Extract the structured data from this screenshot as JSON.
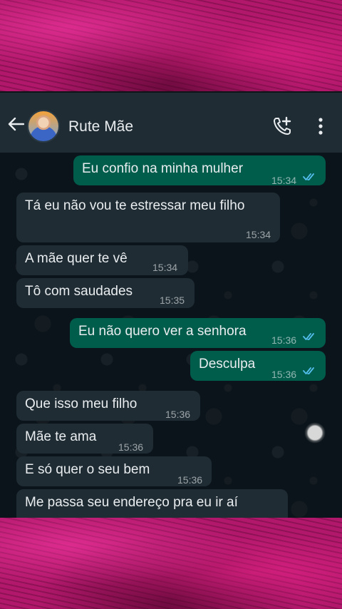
{
  "header": {
    "contact_name": "Rute Mãe",
    "back_icon": "arrow-left-icon",
    "call_icon": "add-call-icon",
    "menu_icon": "more-vertical-icon"
  },
  "colors": {
    "header_bg": "#1f2c34",
    "incoming_bubble": "#1f2c34",
    "outgoing_bubble": "#005c4b",
    "read_ticks": "#53bdeb",
    "frame_magenta": "#b1186b"
  },
  "messages": [
    {
      "direction": "out",
      "text": "Eu confio na minha mulher",
      "time": "15:34",
      "status": "read"
    },
    {
      "direction": "in",
      "text": "Tá eu não vou te estressar meu filho",
      "time": "15:34"
    },
    {
      "direction": "in",
      "text": "A mãe quer te vê",
      "time": "15:34"
    },
    {
      "direction": "in",
      "text": "Tô com saudades",
      "time": "15:35"
    },
    {
      "direction": "out",
      "text": "Eu não quero ver a senhora",
      "time": "15:36",
      "status": "read"
    },
    {
      "direction": "out",
      "text": "Desculpa",
      "time": "15:36",
      "status": "read"
    },
    {
      "direction": "in",
      "text": "Que isso meu filho",
      "time": "15:36"
    },
    {
      "direction": "in",
      "text": "Mãe te ama",
      "time": "15:36"
    },
    {
      "direction": "in",
      "text": "E só quer o seu bem",
      "time": "15:36"
    },
    {
      "direction": "in",
      "text": "Me passa seu endereço pra eu ir aí",
      "time": ""
    }
  ]
}
